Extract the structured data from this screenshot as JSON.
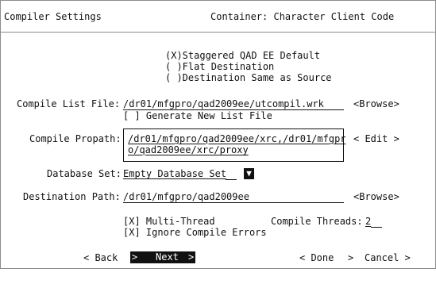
{
  "header": {
    "title": "Compiler Settings",
    "container": "Container: Character Client Code"
  },
  "destination_options": [
    "(X)Staggered QAD EE Default",
    "( )Flat Destination",
    "( )Destination Same as Source"
  ],
  "compile_list": {
    "label": "Compile List File:",
    "value": "/dr01/mfgpro/qad2009ee/utcompil.wrk",
    "browse": "<Browse>",
    "generate_checkbox": "[ ] Generate New List File"
  },
  "propath": {
    "label": "Compile Propath:",
    "line1": "/dr01/mfgpro/qad2009ee/xrc,/dr01/mfgpr",
    "line2": "o/qad2009ee/xrc/proxy",
    "edit": "< Edit >"
  },
  "database_set": {
    "label": "Database Set:",
    "value": "Empty Database Set",
    "dropdown_glyph": "▼"
  },
  "destination_path": {
    "label": "Destination Path:",
    "value": "/dr01/mfgpro/qad2009ee",
    "browse": "<Browse>"
  },
  "options": {
    "multi_thread": "[X] Multi-Thread",
    "ignore_errors": "[X] Ignore Compile Errors",
    "threads_label": "Compile Threads:",
    "threads_value": "2"
  },
  "buttons": {
    "back": "< Back",
    "next": "Next",
    "done": "< Done",
    "cancel": "Cancel >"
  }
}
